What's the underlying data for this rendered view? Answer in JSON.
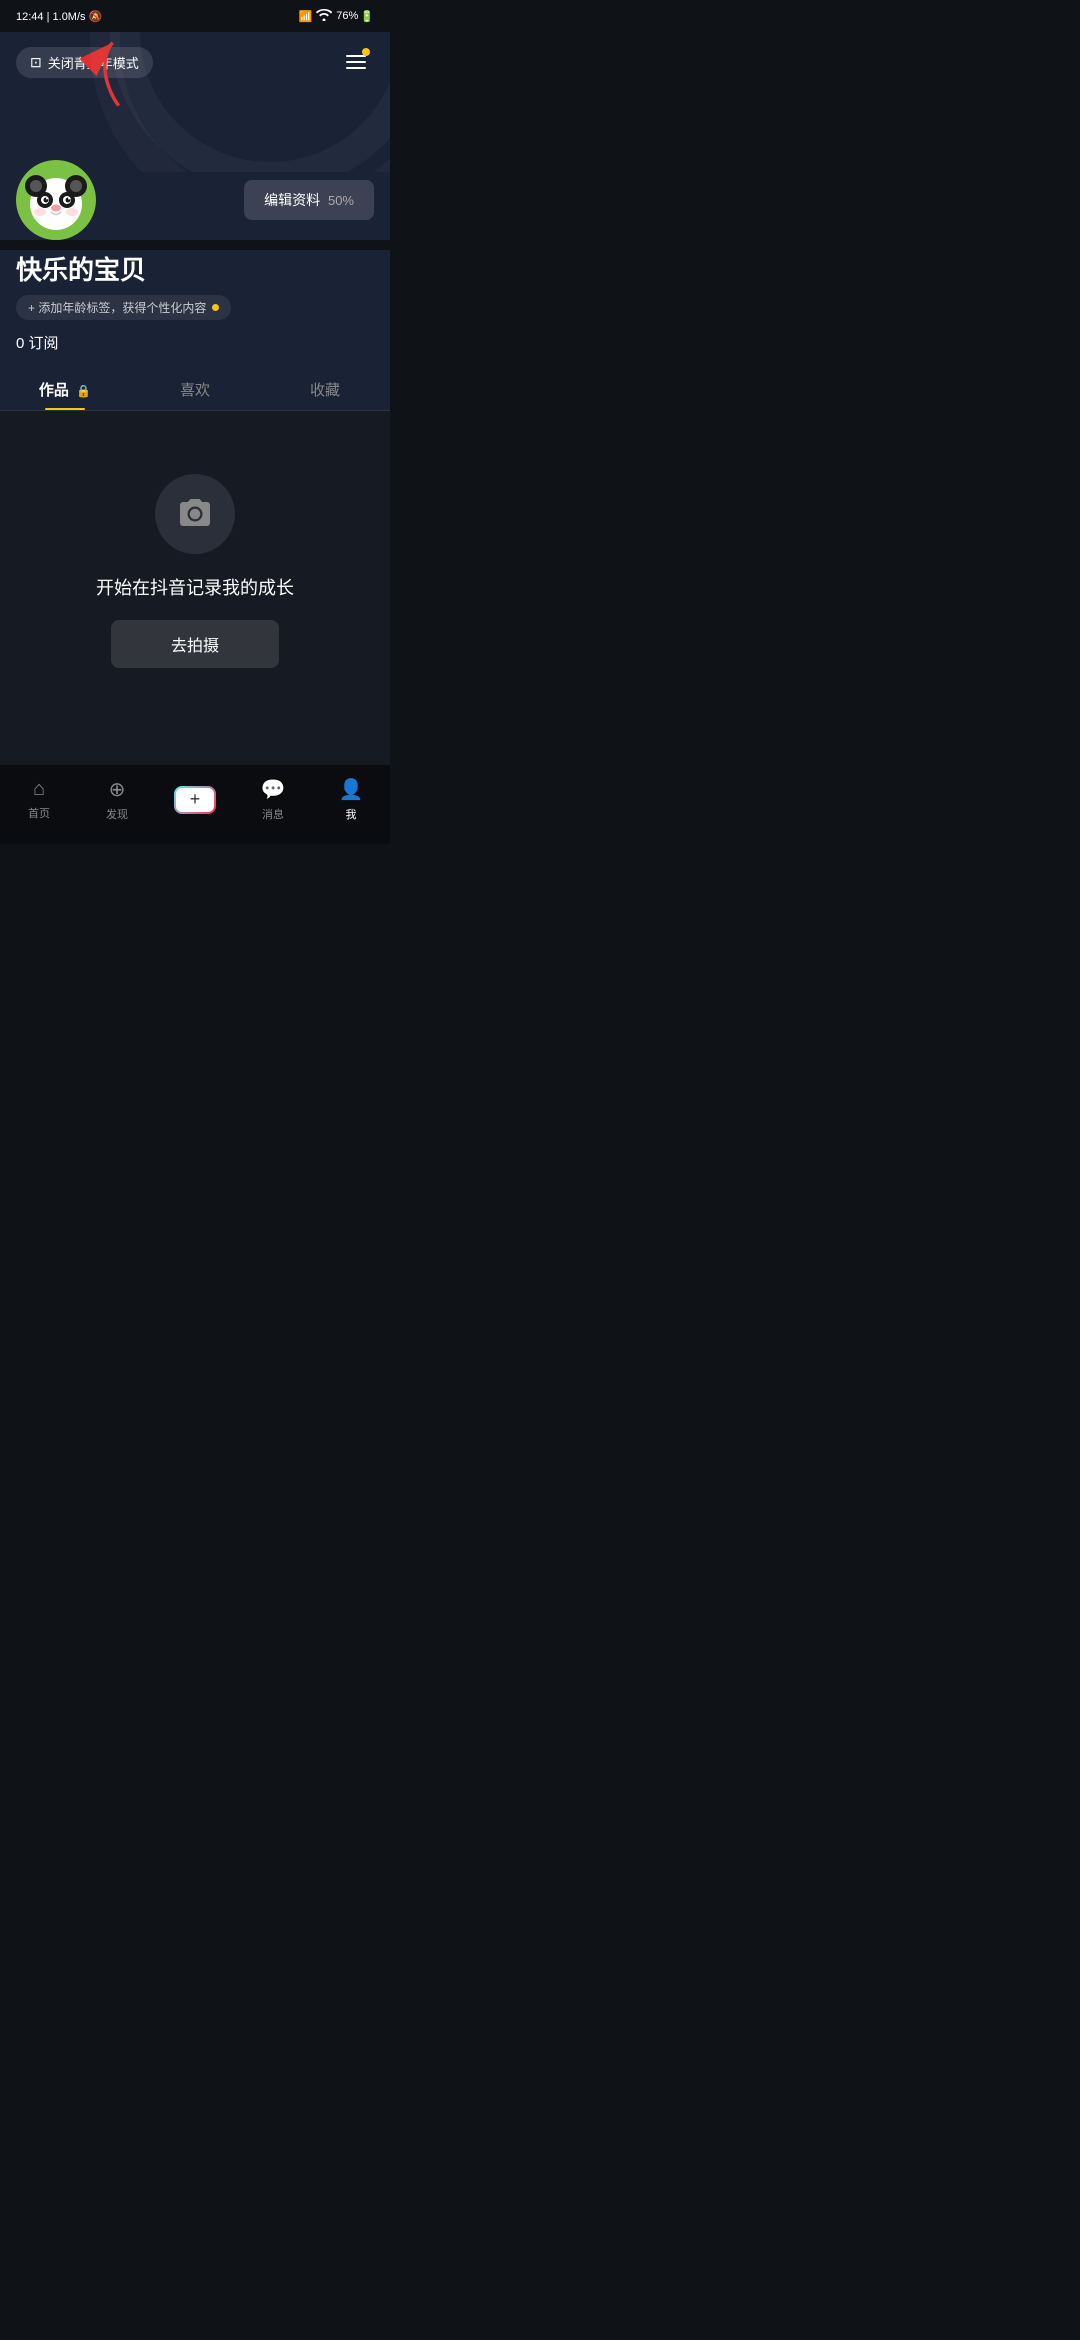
{
  "statusBar": {
    "time": "12:44",
    "network": "1.0M/s",
    "battery": "76%"
  },
  "header": {
    "youthModeLabel": "关闭青少年模式",
    "menuAriaLabel": "菜单"
  },
  "profile": {
    "editBtnLabel": "编辑资料",
    "editBtnPercent": "50%",
    "username": "快乐的宝贝",
    "ageTagLabel": "+ 添加年龄标签，获得个性化内容",
    "subscribeCount": "0 订阅"
  },
  "tabs": [
    {
      "label": "作品",
      "hasLock": true,
      "active": true
    },
    {
      "label": "喜欢",
      "hasLock": false,
      "active": false
    },
    {
      "label": "收藏",
      "hasLock": false,
      "active": false
    }
  ],
  "emptyState": {
    "title": "开始在抖音记录我的成长",
    "shootLabel": "去拍摄"
  },
  "bottomNav": [
    {
      "label": "首页",
      "active": false
    },
    {
      "label": "发现",
      "active": false
    },
    {
      "label": "+",
      "isPlus": true
    },
    {
      "label": "消息",
      "active": false
    },
    {
      "label": "我",
      "active": true
    }
  ]
}
